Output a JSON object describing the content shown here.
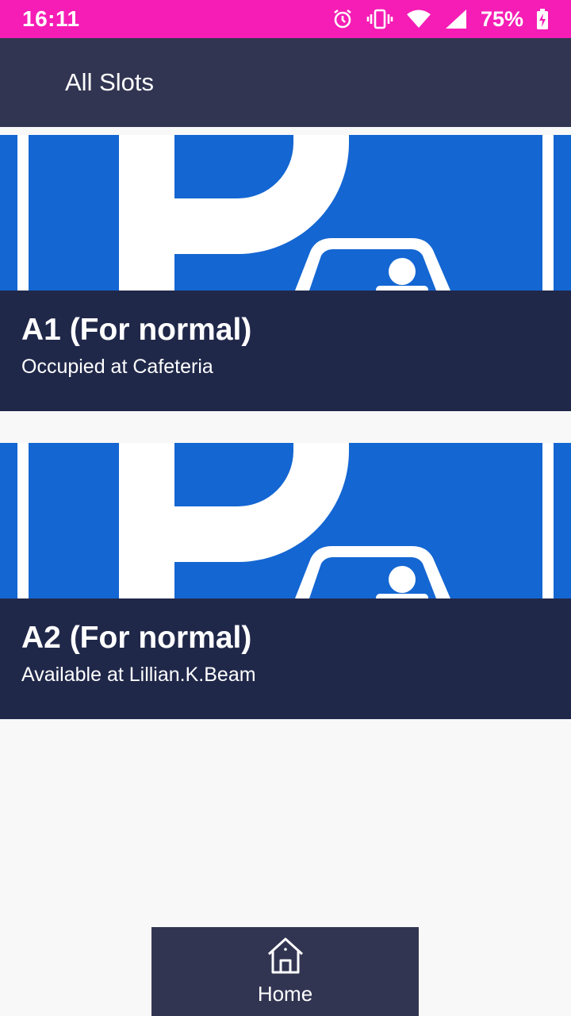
{
  "status_bar": {
    "time": "16:11",
    "battery": "75%",
    "icons": [
      "alarm-icon",
      "vibrate-icon",
      "wifi-icon",
      "signal-icon",
      "battery-charging-icon"
    ],
    "color": "#f51db5"
  },
  "app_bar": {
    "title": "All Slots",
    "color": "#323552"
  },
  "slots": [
    {
      "title": "A1 (For normal)",
      "subtitle": "Occupied at Cafeteria",
      "image_icon": "parking-sign-icon"
    },
    {
      "title": "A2 (For normal)",
      "subtitle": "Available at Lillian.K.Beam",
      "image_icon": "parking-sign-icon"
    }
  ],
  "bottom_nav": {
    "home_label": "Home",
    "home_icon": "home-icon"
  },
  "colors": {
    "card_background": "#20284a",
    "sign_blue": "#1466d2",
    "page_background": "#f8f8f8"
  }
}
